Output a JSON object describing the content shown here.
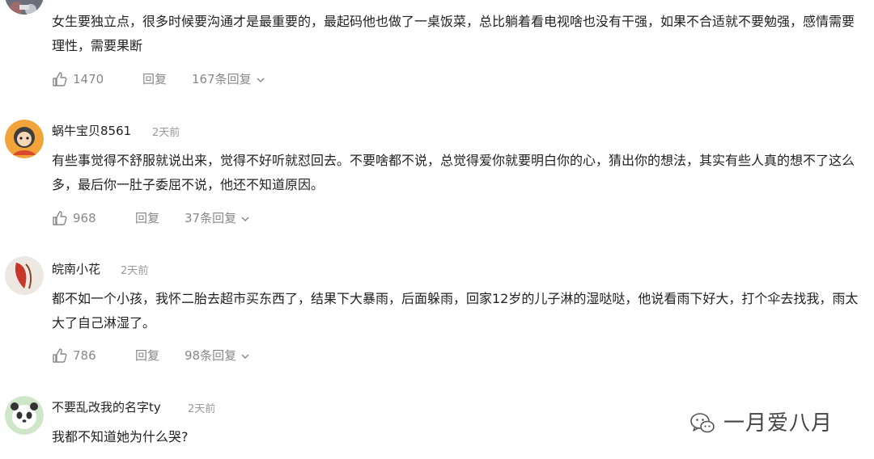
{
  "comments": [
    {
      "content": "女生要独立点，很多时候要沟通才是最重要的，最起码他也做了一桌饭菜，总比躺着看电视啥也没有干强，如果不合适就不要勉强，感情需要理性，需要果断",
      "likes": "1470",
      "reply_label": "回复",
      "replies_label": "167条回复"
    },
    {
      "username": "蜗牛宝贝8561",
      "time": "2天前",
      "content": "有些事觉得不舒服就说出来，觉得不好听就怼回去。不要啥都不说，总觉得爱你就要明白你的心，猜出你的想法，其实有些人真的想不了这么多，最后你一肚子委屈不说，他还不知道原因。",
      "likes": "968",
      "reply_label": "回复",
      "replies_label": "37条回复"
    },
    {
      "username": "皖南小花",
      "time": "2天前",
      "content": "都不如一个小孩，我怀二胎去超市买东西了，结果下大暴雨，后面躲雨，回家12岁的儿子淋的湿哒哒，他说看雨下好大，打个伞去找我，雨太大了自己淋湿了。",
      "likes": "786",
      "reply_label": "回复",
      "replies_label": "98条回复"
    },
    {
      "username": "不要乱改我的名字ty",
      "time": "2天前",
      "content": "我都不知道她为什么哭?"
    }
  ],
  "watermark": {
    "text": "一月爱八月",
    "icon": "wechat-icon"
  },
  "colors": {
    "text": "#222222",
    "meta": "#999999",
    "action": "#888888"
  }
}
